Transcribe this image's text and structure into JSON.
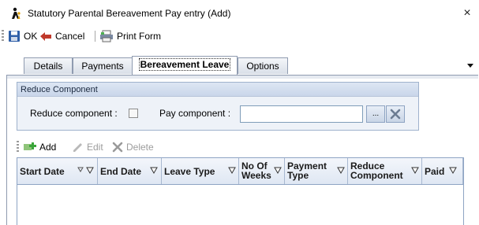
{
  "window": {
    "title": "Statutory Parental Bereavement Pay entry (Add)",
    "close_glyph": "×"
  },
  "toolbar": {
    "ok_label": "OK",
    "cancel_label": "Cancel",
    "print_label": "Print Form"
  },
  "tabs": [
    {
      "label": "Details",
      "active": false
    },
    {
      "label": "Payments",
      "active": false
    },
    {
      "label": "Bereavement Leave",
      "active": true
    },
    {
      "label": "Options",
      "active": false
    }
  ],
  "reduce_group": {
    "header": "Reduce Component",
    "reduce_label": "Reduce component :",
    "reduce_checked": false,
    "pay_label": "Pay component :",
    "pay_value": "",
    "ellipsis_label": "..."
  },
  "grid_toolbar": {
    "add_label": "Add",
    "edit_label": "Edit",
    "delete_label": "Delete"
  },
  "grid": {
    "columns": [
      {
        "label": "Start Date",
        "line2": ""
      },
      {
        "label": "End Date",
        "line2": ""
      },
      {
        "label": "Leave Type",
        "line2": ""
      },
      {
        "label": "No Of",
        "line2": "Weeks"
      },
      {
        "label": "Payment",
        "line2": "Type"
      },
      {
        "label": "Reduce",
        "line2": "Component"
      },
      {
        "label": "Paid",
        "line2": ""
      }
    ],
    "rows": []
  },
  "colors": {
    "accent_blue": "#3c6fb7",
    "ok_icon": "#2f5fa8",
    "cancel_icon": "#c0392b",
    "add_icon": "#3aa53a"
  }
}
